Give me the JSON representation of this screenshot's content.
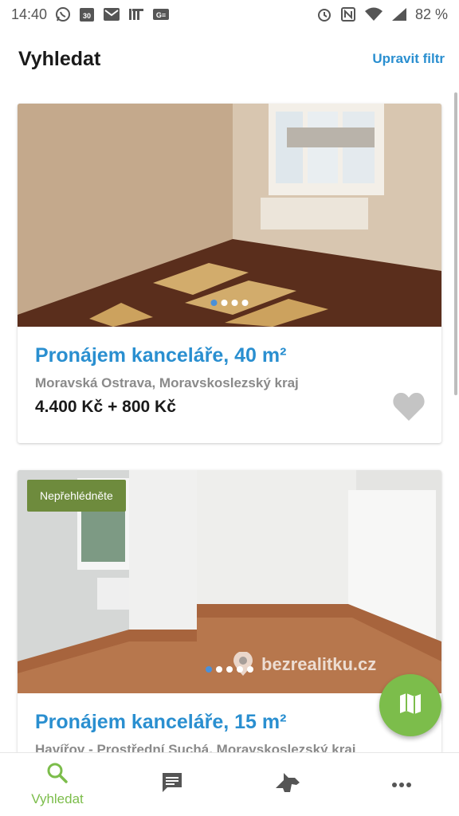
{
  "status_bar": {
    "time": "14:40",
    "battery": "82 %",
    "left_icons": [
      "whatsapp-icon",
      "calendar-icon",
      "gmail-icon",
      "ifttt-icon",
      "ge-icon"
    ],
    "calendar_day": "30",
    "right_icons": [
      "alarm-icon",
      "nfc-icon",
      "wifi-icon",
      "signal-icon"
    ]
  },
  "header": {
    "title": "Vyhledat",
    "edit_filter": "Upravit filtr"
  },
  "listings": [
    {
      "title": "Pronájem kanceláře, 40 m²",
      "location": "Moravská Ostrava, Moravskoslezský kraj",
      "price": "4.400 Kč + 800 Kč",
      "photo_count": 4,
      "active_photo": 1
    },
    {
      "badge": "Nepřehlédněte",
      "title": "Pronájem kanceláře, 15 m²",
      "location": "Havířov - Prostřední Suchá, Moravskoslezský kraj",
      "watermark": "bezrealitku.cz",
      "photo_count": 5,
      "active_photo": 1
    }
  ],
  "bottom_nav": {
    "items": [
      {
        "label": "Vyhledat",
        "icon": "search-icon",
        "active": true
      },
      {
        "label": "",
        "icon": "messages-icon",
        "active": false
      },
      {
        "label": "",
        "icon": "watchdog-icon",
        "active": false
      },
      {
        "label": "",
        "icon": "more-icon",
        "active": false
      }
    ]
  },
  "colors": {
    "accent_blue": "#2a8fd0",
    "accent_green": "#7cbd4b",
    "badge_green": "#6e8b3d"
  }
}
